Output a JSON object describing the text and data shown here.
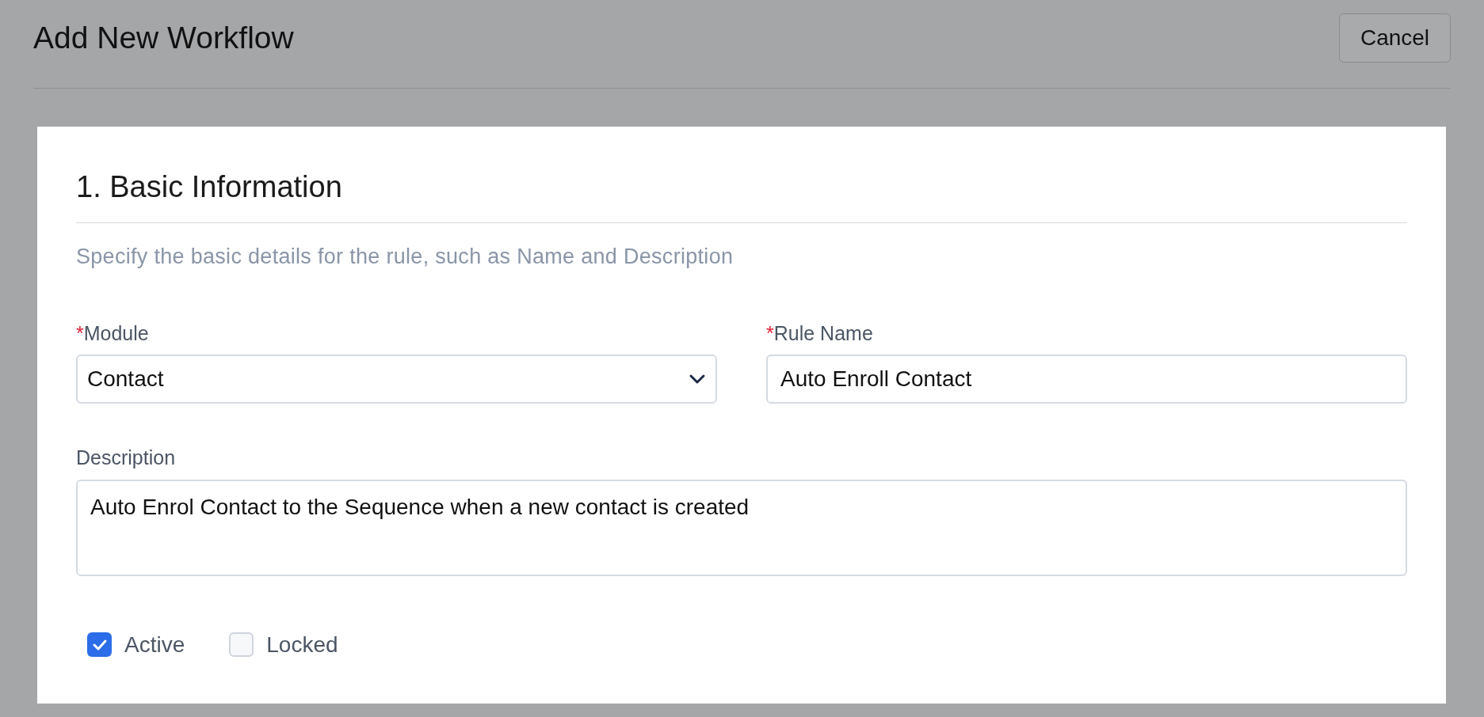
{
  "header": {
    "title": "Add New Workflow",
    "cancel_button": "Cancel"
  },
  "section": {
    "title": "1. Basic Information",
    "subtitle": "Specify the basic details for the rule, such as Name and Description",
    "fields": [
      {
        "kind": "select",
        "required_mark": "*",
        "label": "Module",
        "value": "Contact"
      },
      {
        "kind": "text",
        "required_mark": "*",
        "label": "Rule Name",
        "value": "Auto Enroll Contact"
      }
    ],
    "description": {
      "label": "Description",
      "value": "Auto Enrol Contact to the Sequence when a new contact is created"
    },
    "checkboxes": [
      {
        "label": "Active",
        "checked": true
      },
      {
        "label": "Locked",
        "checked": false
      }
    ]
  }
}
